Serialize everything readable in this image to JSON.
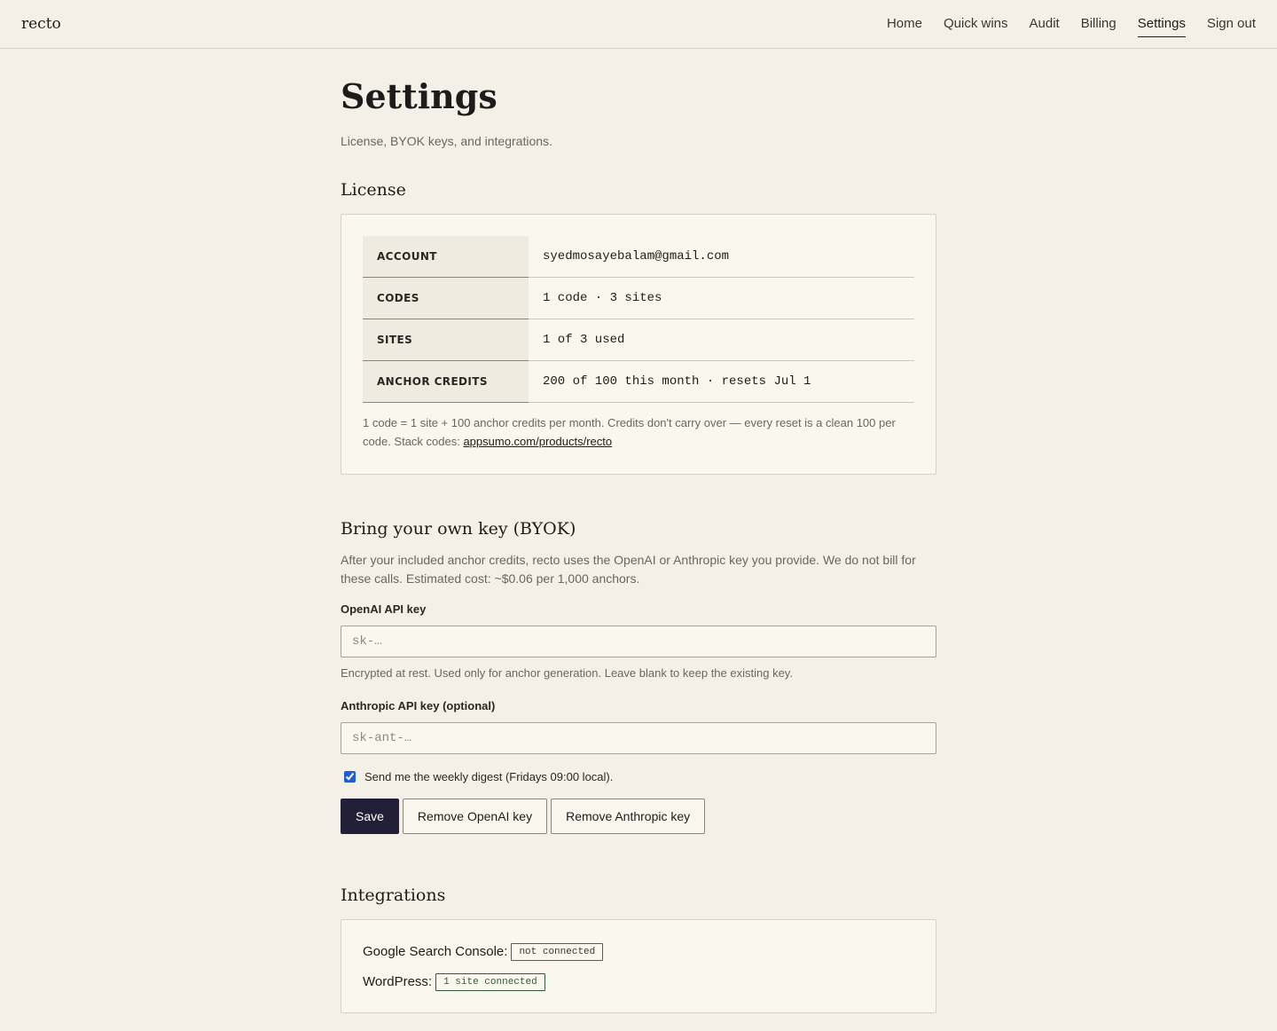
{
  "app": {
    "brand": "recto"
  },
  "nav": {
    "items": [
      {
        "label": "Home",
        "active": false
      },
      {
        "label": "Quick wins",
        "active": false
      },
      {
        "label": "Audit",
        "active": false
      },
      {
        "label": "Billing",
        "active": false
      },
      {
        "label": "Settings",
        "active": true
      },
      {
        "label": "Sign out",
        "active": false
      }
    ]
  },
  "page": {
    "title": "Settings",
    "subtitle": "License, BYOK keys, and integrations."
  },
  "license": {
    "heading": "License",
    "rows": [
      {
        "label": "ACCOUNT",
        "value": "syedmosayebalam@gmail.com"
      },
      {
        "label": "CODES",
        "value": "1 code · 3 sites"
      },
      {
        "label": "SITES",
        "value": "1 of 3 used"
      },
      {
        "label": "ANCHOR CREDITS",
        "value": "200 of 100 this month · resets Jul 1"
      }
    ],
    "note": "1 code = 1 site + 100 anchor credits per month. Credits don't carry over — every reset is a clean 100 per code. Stack codes: ",
    "link_text": "appsumo.com/products/recto"
  },
  "byok": {
    "heading": "Bring your own key (BYOK)",
    "description": "After your included anchor credits, recto uses the OpenAI or Anthropic key you provide. We do not bill for these calls. Estimated cost: ~$0.06 per 1,000 anchors.",
    "openai_label": "OpenAI API key",
    "openai_value": "",
    "openai_placeholder": "sk-…",
    "openai_hint": "Encrypted at rest. Used only for anchor generation. Leave blank to keep the existing key.",
    "anthropic_label": "Anthropic API key (optional)",
    "anthropic_value": "",
    "anthropic_placeholder": "sk-ant-…",
    "digest_label": "Send me the weekly digest (Fridays 09:00 local).",
    "digest_checked": true,
    "save_label": "Save",
    "remove_openai_label": "Remove OpenAI key",
    "remove_anthropic_label": "Remove Anthropic key"
  },
  "integrations": {
    "heading": "Integrations",
    "gsc_label": "Google Search Console:",
    "gsc_status": "not connected",
    "wp_label": "WordPress:",
    "wp_status": "1 site connected"
  },
  "colors": {
    "background": "#f4f0e8",
    "card": "#faf7ef",
    "primary_button": "#241f38",
    "text": "#1e1c1a",
    "muted": "#6b665f"
  }
}
